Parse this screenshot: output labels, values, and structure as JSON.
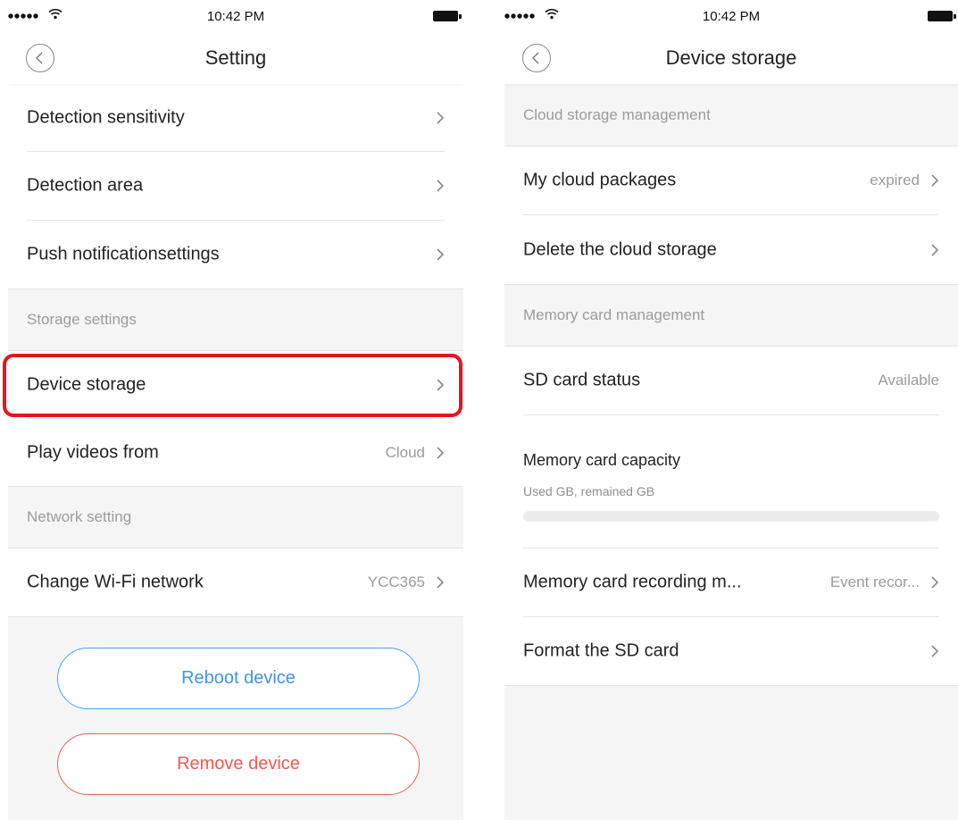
{
  "status_bar": {
    "time": "10:42 PM"
  },
  "left_screen": {
    "title": "Setting",
    "items": [
      {
        "label": "Detection sensitivity"
      },
      {
        "label": "Detection area"
      },
      {
        "label": "Push notificationsettings"
      }
    ],
    "storage_section": "Storage settings",
    "device_storage_label": "Device storage",
    "play_videos_label": "Play videos from",
    "play_videos_value": "Cloud",
    "network_section": "Network setting",
    "wifi_label": "Change Wi-Fi network",
    "wifi_value": "YCC365",
    "reboot_label": "Reboot device",
    "remove_label": "Remove device",
    "colors": {
      "reboot": "#3d96ea",
      "remove": "#ef5a52",
      "highlight": "#e8141b"
    }
  },
  "right_screen": {
    "title": "Device storage",
    "cloud_section": "Cloud storage management",
    "cloud_packages_label": "My cloud packages",
    "cloud_packages_value": "expired",
    "delete_cloud_label": "Delete the cloud storage",
    "memory_section": "Memory card management",
    "sd_status_label": "SD card status",
    "sd_status_value": "Available",
    "capacity_label": "Memory card capacity",
    "capacity_detail": "Used GB,  remained GB",
    "capacity_used_fraction": 0,
    "recording_mode_label": "Memory card recording m...",
    "recording_mode_value": "Event recor...",
    "format_label": "Format the SD card"
  },
  "icons": [
    "signal-dots-icon",
    "wifi-icon",
    "battery-icon",
    "back-icon",
    "chevron-right-icon"
  ]
}
